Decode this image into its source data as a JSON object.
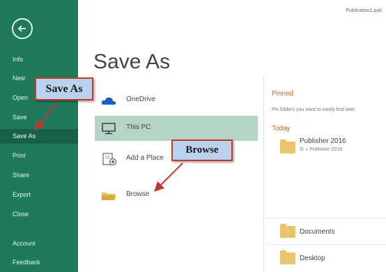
{
  "window": {
    "doc_name": "Publication1.pub"
  },
  "sidebar": {
    "items": [
      {
        "label": "Info"
      },
      {
        "label": "New"
      },
      {
        "label": "Open"
      },
      {
        "label": "Save"
      },
      {
        "label": "Save As"
      },
      {
        "label": "Print"
      },
      {
        "label": "Share"
      },
      {
        "label": "Export"
      },
      {
        "label": "Close"
      },
      {
        "label": "Account"
      },
      {
        "label": "Feedback"
      }
    ]
  },
  "main": {
    "title": "Save As",
    "locations": [
      {
        "label": "OneDrive",
        "icon": "onedrive-cloud-icon"
      },
      {
        "label": "This PC",
        "icon": "computer-icon",
        "selected": true
      },
      {
        "label": "Add a Place",
        "icon": "add-place-icon"
      },
      {
        "label": "Browse",
        "icon": "folder-icon"
      }
    ]
  },
  "right_panel": {
    "pinned_heading": "Pinned",
    "pinned_hint": "Pin folders you want to easily find later.",
    "today_heading": "Today",
    "recent": {
      "title": "Publisher 2016",
      "path": "S: » Publisher 2016"
    },
    "folders": [
      {
        "label": "Documents"
      },
      {
        "label": "Desktop"
      }
    ]
  },
  "annotations": {
    "save_as_callout": "Save As",
    "browse_callout": "Browse"
  },
  "colors": {
    "sidebar": "#1f7a5c",
    "selected": "#b4d4c5",
    "accent": "#c06a17",
    "callout_border": "#c0392b",
    "callout_fill": "#b9d2ee",
    "folder": "#e9c46a"
  }
}
